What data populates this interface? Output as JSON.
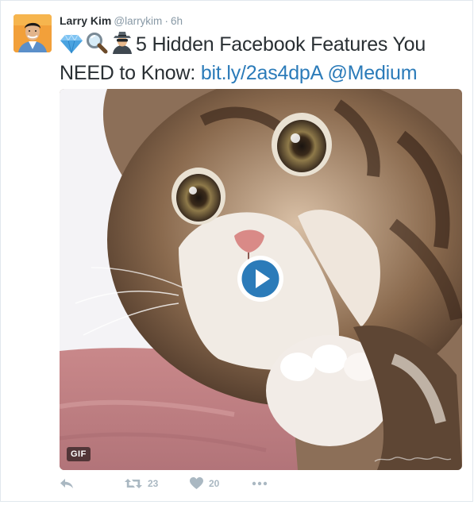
{
  "tweet": {
    "display_name": "Larry Kim",
    "handle": "@larrykim",
    "separator": "·",
    "time": "6h",
    "text_before": "5 Hidden Facebook Features You NEED to Know:",
    "link": "bit.ly/2as4dpA",
    "mention": "@Medium",
    "emojis": [
      "gem-icon",
      "magnifier-icon",
      "spy-icon"
    ]
  },
  "media": {
    "badge": "GIF",
    "watermark": "littleanimalgifs"
  },
  "actions": {
    "retweet_count": "23",
    "like_count": "20"
  },
  "colors": {
    "link": "#2b7bb9",
    "muted": "#8899a6",
    "action_icon": "#aab8c2"
  }
}
